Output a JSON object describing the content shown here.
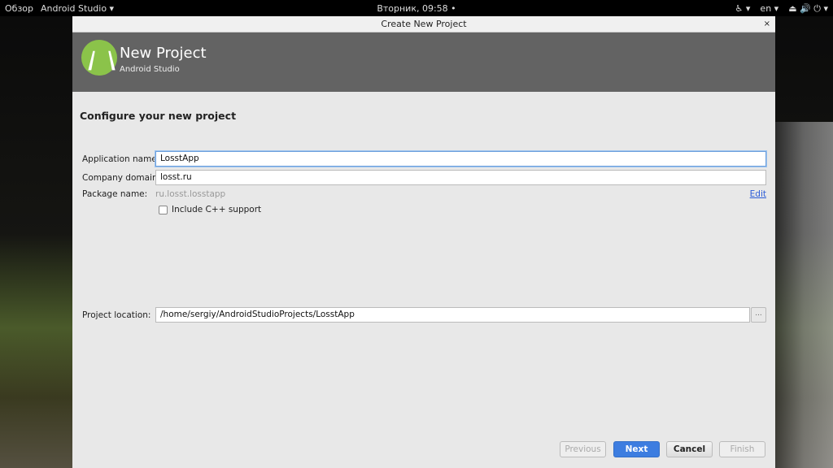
{
  "topbar": {
    "overview": "Обзор",
    "app": "Android Studio ▾",
    "clock": "Вторник, 09:58 •",
    "accessibility": "♿ ▾",
    "lang": "en ▾",
    "system": "⏏ 🔊 ⏻ ▾"
  },
  "dialog": {
    "title": "Create New Project",
    "close": "×",
    "header": {
      "title": "New Project",
      "subtitle": "Android Studio"
    },
    "heading": "Configure your new project",
    "app_name_label": "Application name:",
    "app_name_value": "LosstApp",
    "company_label": "Company domain:",
    "company_value": "losst.ru",
    "package_label": "Package name:",
    "package_value": "ru.losst.losstapp",
    "edit": "Edit",
    "cpp_label": "Include C++ support",
    "location_label": "Project location:",
    "location_value": "/home/sergiy/AndroidStudioProjects/LosstApp",
    "browse": "...",
    "buttons": {
      "previous": "Previous",
      "next": "Next",
      "cancel": "Cancel",
      "finish": "Finish"
    }
  }
}
